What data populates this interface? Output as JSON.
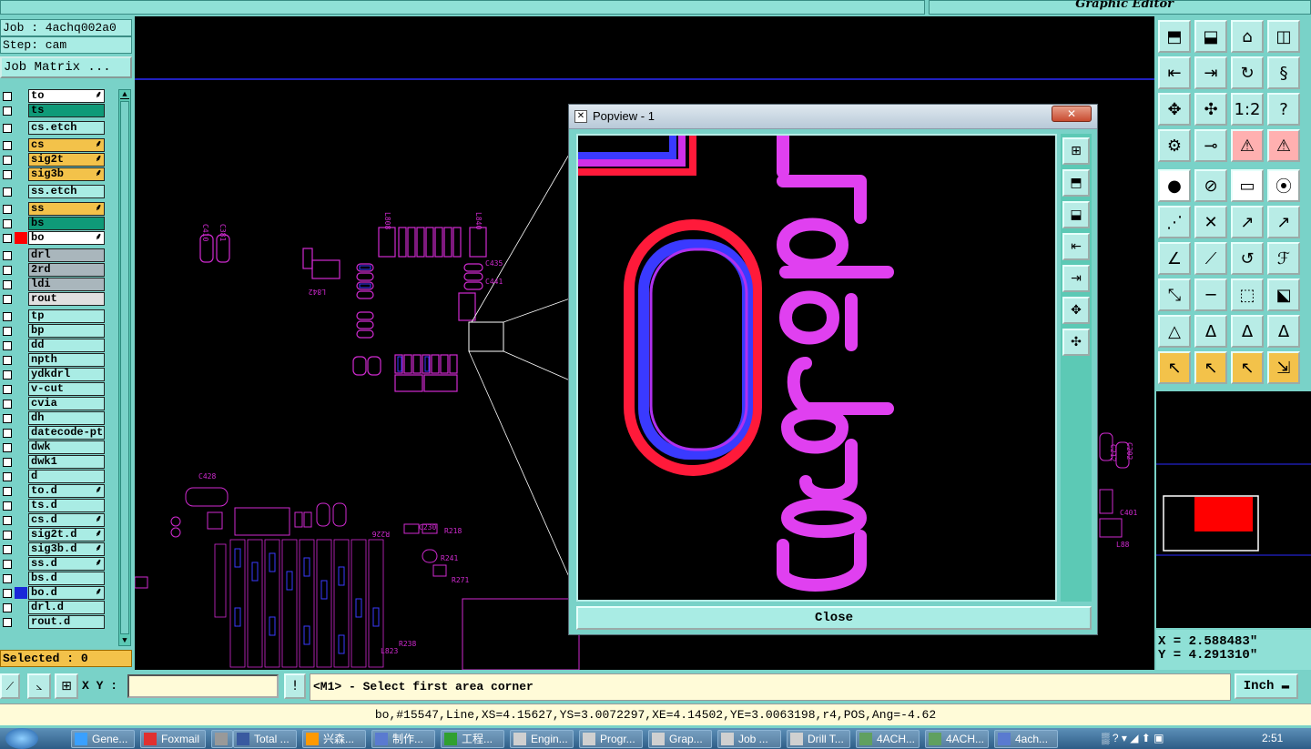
{
  "window": {
    "editor_title": "Graphic Editor"
  },
  "left": {
    "job": "Job : 4achq002a0",
    "step": "Step: cam",
    "job_matrix": "Job Matrix ...",
    "selected": "Selected : 0"
  },
  "layers": [
    {
      "name": "to",
      "color": "#ffffff",
      "mark": "⸙"
    },
    {
      "name": "ts",
      "color": "#0f9a78",
      "mark": ""
    },
    {
      "name": "cs.etch",
      "color": "#a9ece4",
      "mark": ""
    },
    {
      "name": "cs",
      "color": "#f3c24a",
      "mark": "⸙"
    },
    {
      "name": "sig2t",
      "color": "#f3c24a",
      "mark": "⸙"
    },
    {
      "name": "sig3b",
      "color": "#f3c24a",
      "mark": "⸙"
    },
    {
      "name": "ss.etch",
      "color": "#a9ece4",
      "mark": ""
    },
    {
      "name": "ss",
      "color": "#f3c24a",
      "mark": "⸙"
    },
    {
      "name": "bs",
      "color": "#0f9a78",
      "mark": ""
    },
    {
      "name": "bo",
      "color": "#ffffff",
      "mark": "⸙",
      "chip": "#ff0000"
    },
    {
      "name": "drl",
      "color": "#a9b6bc",
      "mark": ""
    },
    {
      "name": "2rd",
      "color": "#a9b6bc",
      "mark": ""
    },
    {
      "name": "ldi",
      "color": "#a9b6bc",
      "mark": ""
    },
    {
      "name": "rout",
      "color": "#e0e0e0",
      "mark": ""
    },
    {
      "name": "tp",
      "color": "#a9ece4",
      "mark": ""
    },
    {
      "name": "bp",
      "color": "#a9ece4",
      "mark": ""
    },
    {
      "name": "dd",
      "color": "#a9ece4",
      "mark": ""
    },
    {
      "name": "npth",
      "color": "#a9ece4",
      "mark": ""
    },
    {
      "name": "ydkdrl",
      "color": "#a9ece4",
      "mark": ""
    },
    {
      "name": "v-cut",
      "color": "#a9ece4",
      "mark": ""
    },
    {
      "name": "cvia",
      "color": "#a9ece4",
      "mark": ""
    },
    {
      "name": "dh",
      "color": "#a9ece4",
      "mark": ""
    },
    {
      "name": "datecode-pt",
      "color": "#a9ece4",
      "mark": ""
    },
    {
      "name": "dwk",
      "color": "#a9ece4",
      "mark": ""
    },
    {
      "name": "dwk1",
      "color": "#a9ece4",
      "mark": ""
    },
    {
      "name": "d",
      "color": "#a9ece4",
      "mark": ""
    },
    {
      "name": "to.d",
      "color": "#a9ece4",
      "mark": "⸙"
    },
    {
      "name": "ts.d",
      "color": "#a9ece4",
      "mark": ""
    },
    {
      "name": "cs.d",
      "color": "#a9ece4",
      "mark": "⸙"
    },
    {
      "name": "sig2t.d",
      "color": "#a9ece4",
      "mark": "⸙"
    },
    {
      "name": "sig3b.d",
      "color": "#a9ece4",
      "mark": "⸙"
    },
    {
      "name": "ss.d",
      "color": "#a9ece4",
      "mark": "⸙"
    },
    {
      "name": "bs.d",
      "color": "#a9ece4",
      "mark": ""
    },
    {
      "name": "bo.d",
      "color": "#a9ece4",
      "mark": "⸙",
      "chip": "#1a28d8"
    },
    {
      "name": "drl.d",
      "color": "#a9ece4",
      "mark": ""
    },
    {
      "name": "rout.d",
      "color": "#a9ece4",
      "mark": ""
    }
  ],
  "popup": {
    "title": "Popview - 1",
    "close_label": "Close",
    "close_x": "✕"
  },
  "coords": {
    "x": "X = 2.588483\"",
    "y": "Y = 4.291310\""
  },
  "cmd": {
    "xy_label": "X Y :",
    "xy_value": "",
    "message": "<M1> - Select first area corner",
    "unit": "Inch ▬"
  },
  "status": "bo,#15547,Line,XS=4.15627,YS=3.0072297,XE=4.14502,YE=3.0063198,r4,POS,Ang=-4.62",
  "taskbar": {
    "items": [
      "Gene...",
      "Foxmail",
      "",
      "Total ...",
      "兴森...",
      "制作...",
      "工程...",
      "Engin...",
      "Progr...",
      "Grap...",
      "Job ...",
      "Drill T...",
      "4ACH...",
      "4ACH...",
      "4ach..."
    ],
    "clock": "2:51"
  }
}
